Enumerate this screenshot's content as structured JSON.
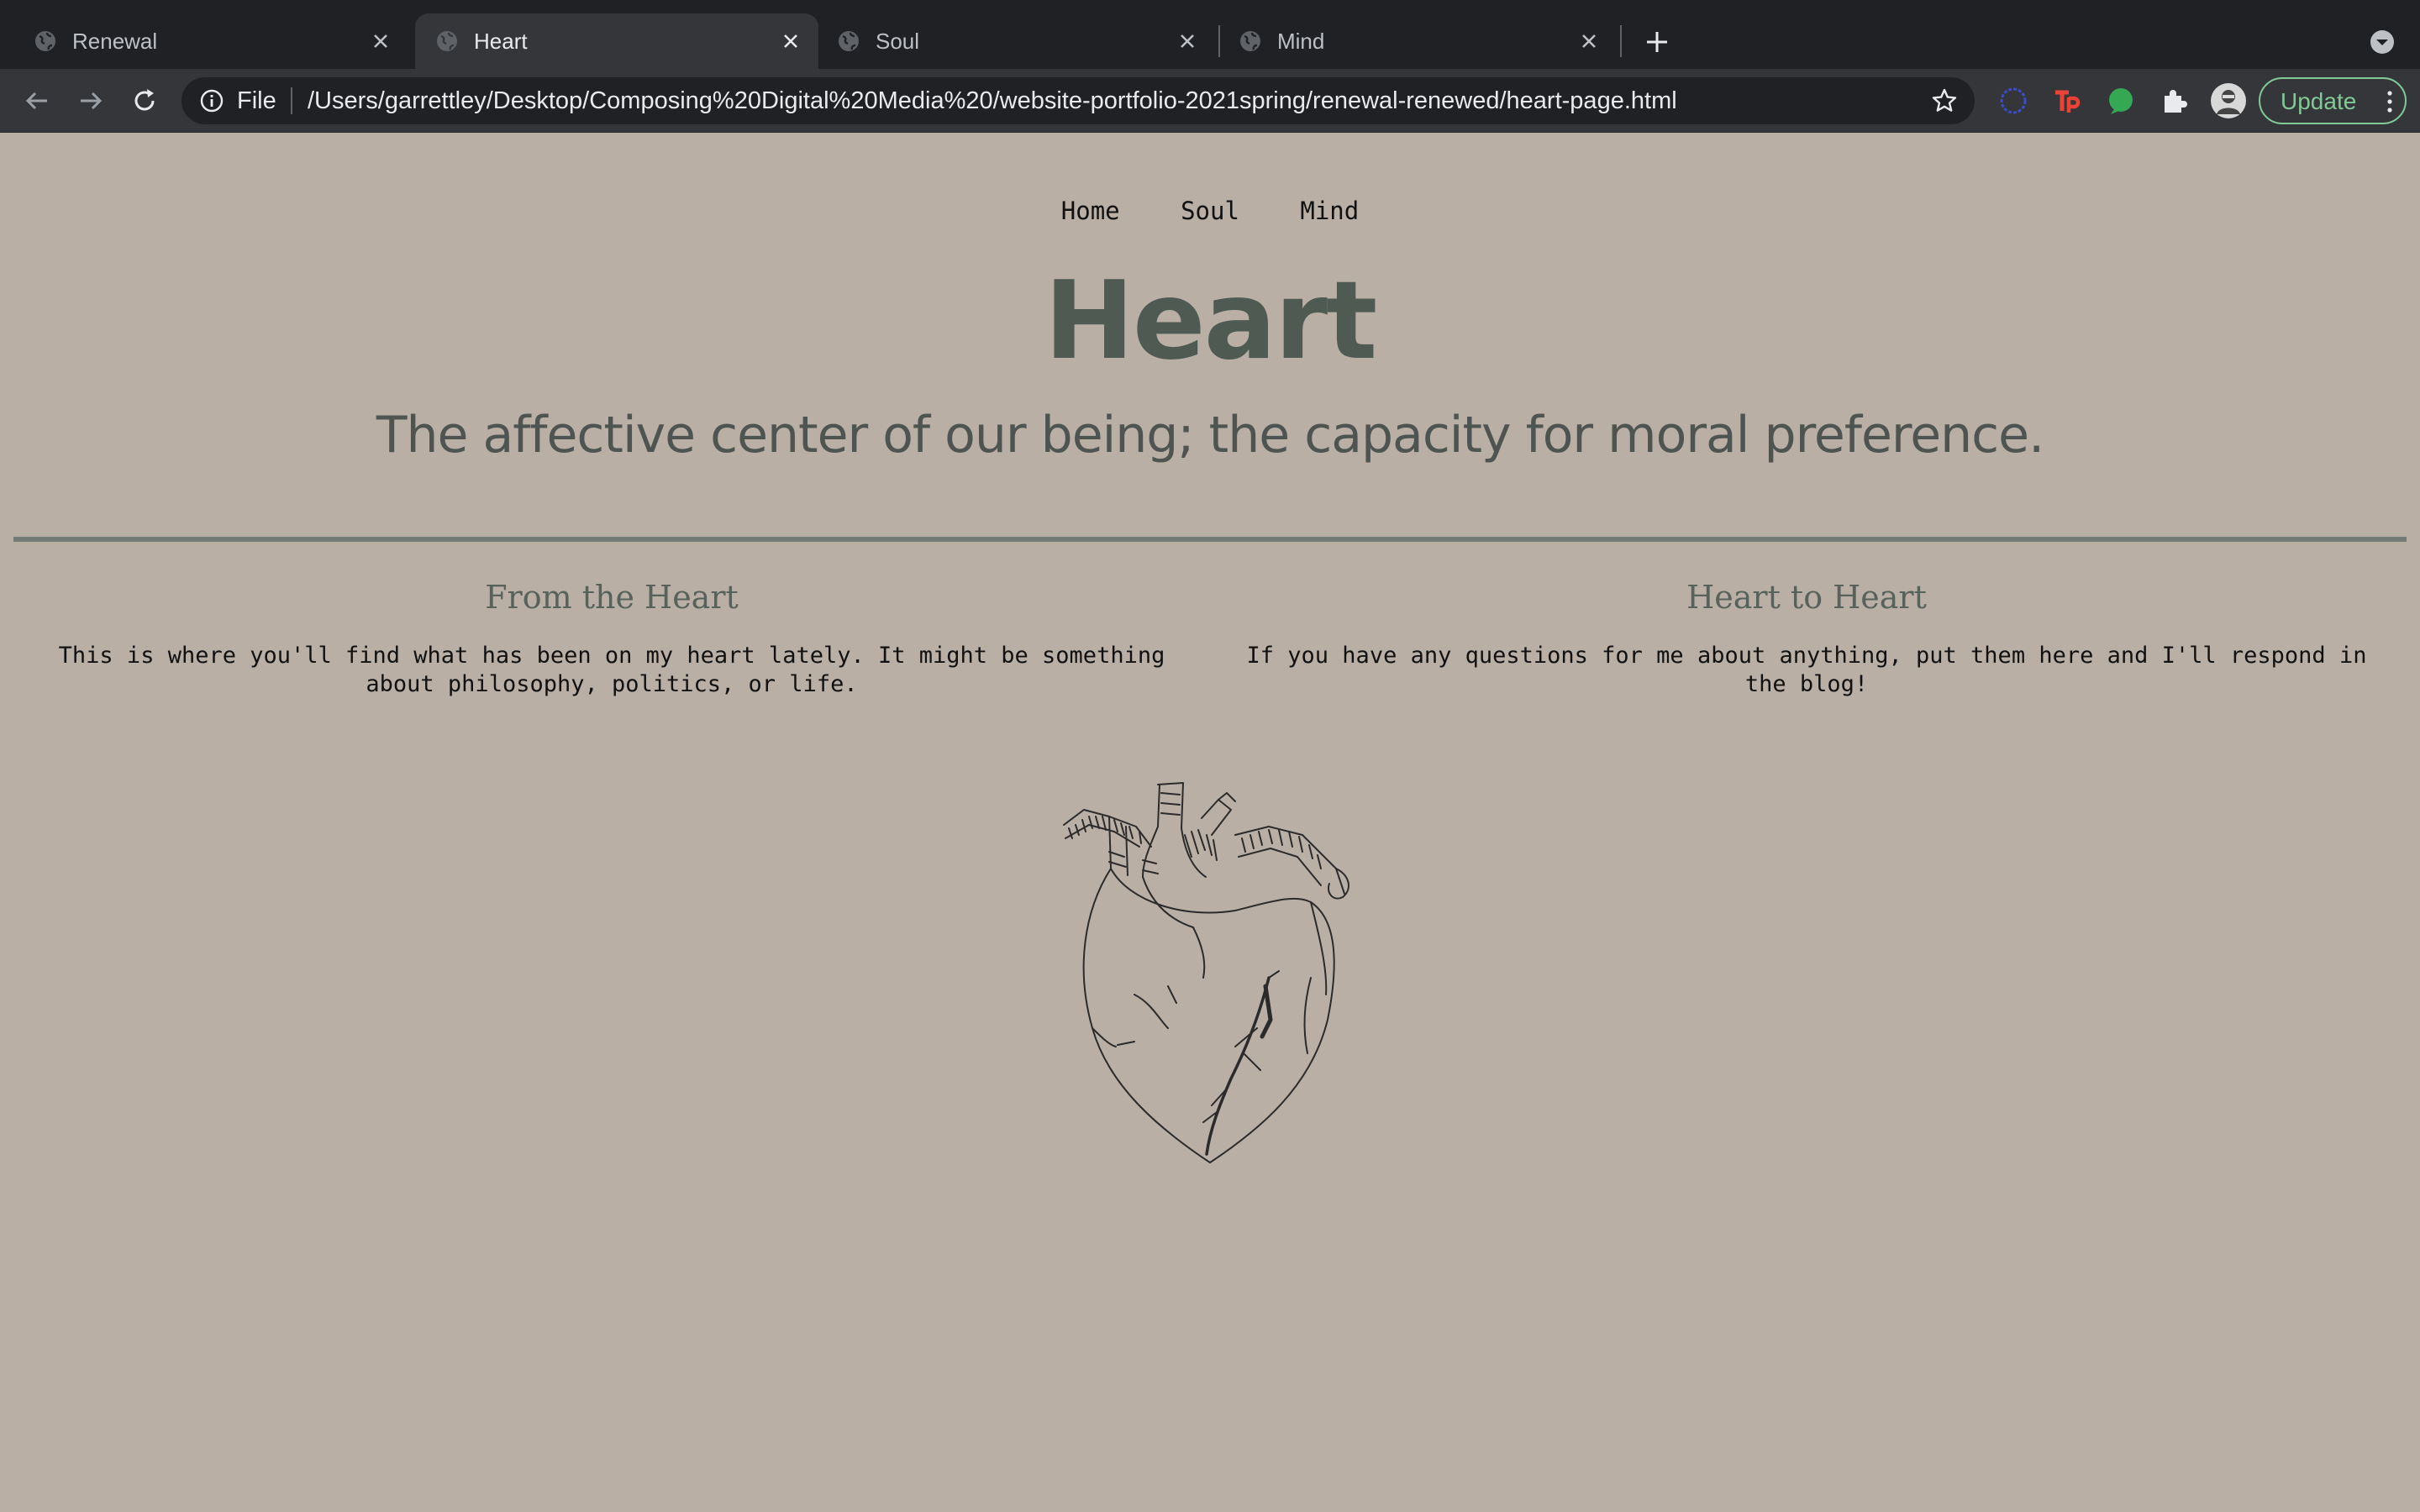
{
  "browser": {
    "tabs": [
      {
        "title": "Renewal",
        "active": false
      },
      {
        "title": "Heart",
        "active": true
      },
      {
        "title": "Soul",
        "active": false
      },
      {
        "title": "Mind",
        "active": false
      }
    ],
    "address": {
      "scheme_label": "File",
      "url": "/Users/garrettley/Desktop/Composing%20Digital%20Media%20/website-portfolio-2021spring/renewal-renewed/heart-page.html"
    },
    "update_label": "Update",
    "icons": [
      "globe-icon",
      "close-icon",
      "plus-icon",
      "chevron-down-icon",
      "back-arrow-icon",
      "forward-arrow-icon",
      "reload-icon",
      "info-icon",
      "star-icon",
      "extension-ring-icon",
      "tp-icon",
      "green-dot-icon",
      "puzzle-icon",
      "avatar",
      "kebab-icon"
    ],
    "colors": {
      "update_accent": "#81c995",
      "tp_icon": "#ea4335",
      "green_ext": "#34a853"
    }
  },
  "page": {
    "nav": [
      {
        "label": "Home"
      },
      {
        "label": "Soul"
      },
      {
        "label": "Mind"
      }
    ],
    "title": "Heart",
    "tagline": "The affective center of our being; the capacity for moral preference.",
    "columns": [
      {
        "heading": "From the Heart",
        "body": "This is where you'll find what has been on my heart lately. It might be something about philosophy, politics, or life."
      },
      {
        "heading": "Heart to Heart",
        "body": "If you have any questions for me about anything, put them here and I'll respond in the blog!"
      }
    ],
    "colors": {
      "background": "#b9afa5",
      "title": "#4f5a52",
      "rule": "#727b75"
    }
  }
}
